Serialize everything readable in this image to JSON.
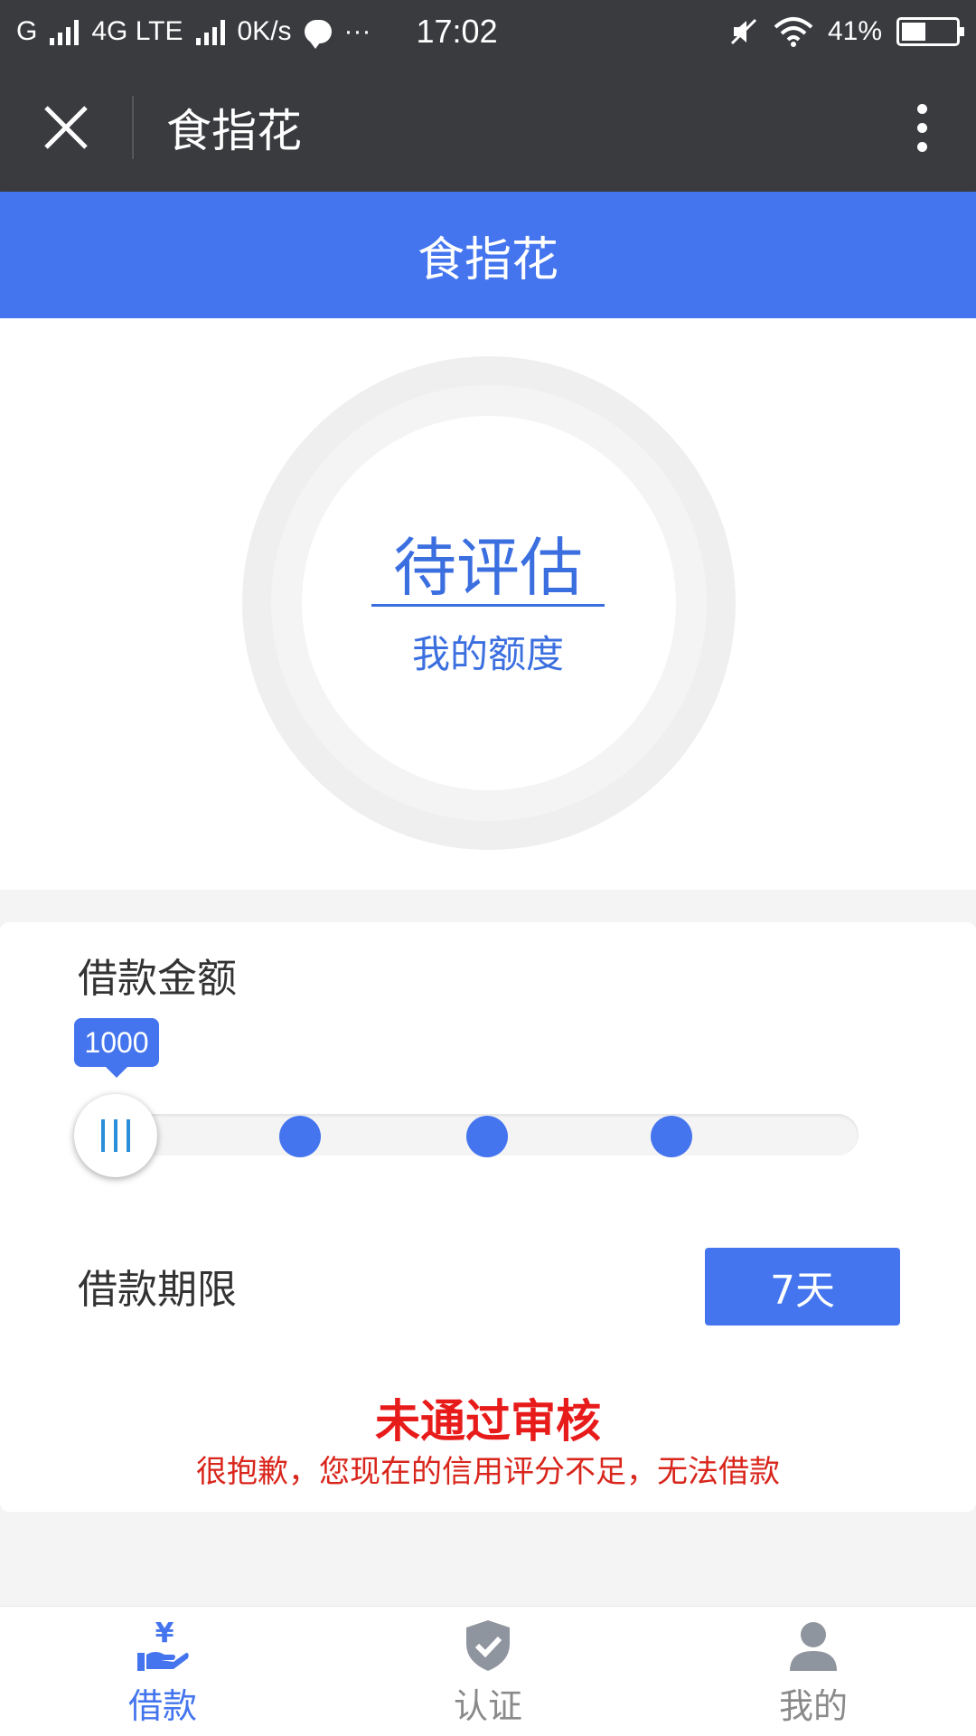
{
  "status_bar": {
    "carrier": "G",
    "network": "4G LTE",
    "speed": "0K/s",
    "more": "···",
    "time": "17:02",
    "battery": "41%"
  },
  "app_bar": {
    "title": "食指花"
  },
  "header": {
    "title": "食指花"
  },
  "credit": {
    "status": "待评估",
    "label": "我的额度"
  },
  "loan": {
    "amount_label": "借款金额",
    "amount_value": "1000",
    "slider_levels": 5,
    "slider_selected_index": 0,
    "term_label": "借款期限",
    "term_value": "7天"
  },
  "review": {
    "title": "未通过审核",
    "message": "很抱歉，您现在的信用评分不足，无法借款"
  },
  "bottom_nav": {
    "items": [
      {
        "label": "借款",
        "icon": "loan-hand-yen-icon",
        "active": true
      },
      {
        "label": "认证",
        "icon": "shield-check-icon",
        "active": false
      },
      {
        "label": "我的",
        "icon": "user-icon",
        "active": false
      }
    ]
  },
  "colors": {
    "primary": "#4475ee",
    "dark_bar": "#3a3b3f",
    "error": "#e81b1b"
  }
}
